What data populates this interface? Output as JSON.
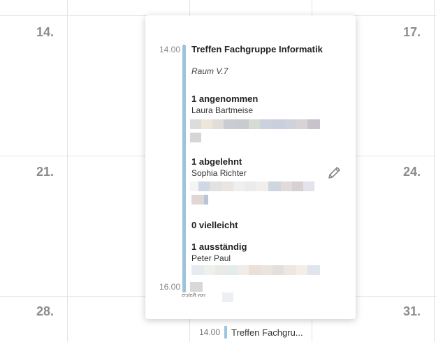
{
  "calendar": {
    "days": {
      "d14": "14.",
      "d17": "17.",
      "d21": "21.",
      "d24": "24.",
      "d28": "28.",
      "d31": "31."
    },
    "bottom_event": {
      "time": "14.00",
      "title": "Treffen Fachgru..."
    }
  },
  "popover": {
    "time_start": "14.00",
    "time_end": "16.00",
    "title": "Treffen Fachgruppe Informatik",
    "room": "Raum V.7",
    "accepted_header": "1 angenommen",
    "accepted": [
      "Laura Bartmeise"
    ],
    "declined_header": "1 abgelehnt",
    "declined": [
      "Sophia Richter"
    ],
    "maybe_header": "0 vielleicht",
    "pending_header": "1 ausständig",
    "pending": [
      "Peter Paul"
    ],
    "created_by_label": "erstellt von",
    "edit_icon": "pencil-icon"
  }
}
